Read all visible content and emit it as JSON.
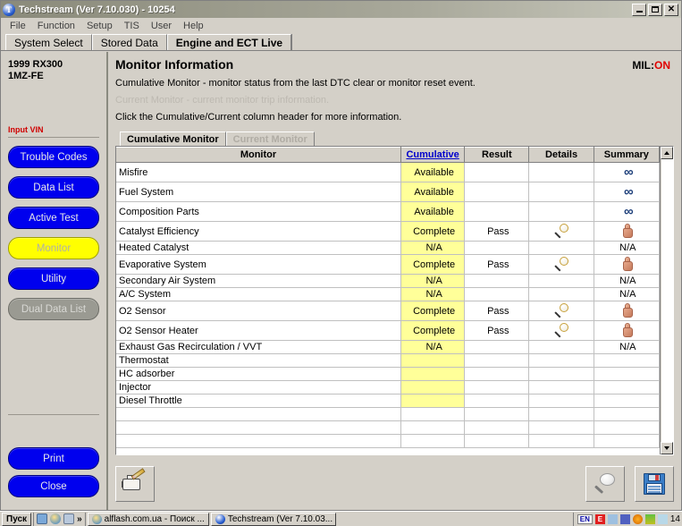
{
  "window": {
    "title": "Techstream (Ver 7.10.030) - 10254",
    "icon": "techstream-logo-icon",
    "minimize_label": "Minimize",
    "maximize_label": "Maximize",
    "close_label": "Close"
  },
  "menubar": {
    "items": [
      "File",
      "Function",
      "Setup",
      "TIS",
      "User",
      "Help"
    ]
  },
  "top_tabs": [
    {
      "label": "System Select",
      "active": false
    },
    {
      "label": "Stored Data",
      "active": false
    },
    {
      "label": "Engine and ECT Live",
      "active": true
    }
  ],
  "sidebar": {
    "vehicle_line1": "1999 RX300",
    "vehicle_line2": "1MZ-FE",
    "vin_label": "Input VIN",
    "nav_buttons": [
      {
        "label": "Trouble Codes",
        "state": "normal"
      },
      {
        "label": "Data List",
        "state": "normal"
      },
      {
        "label": "Active Test",
        "state": "normal"
      },
      {
        "label": "Monitor",
        "state": "selected"
      },
      {
        "label": "Utility",
        "state": "normal"
      },
      {
        "label": "Dual Data List",
        "state": "disabled"
      }
    ],
    "bottom_buttons": [
      {
        "label": "Print"
      },
      {
        "label": "Close"
      }
    ]
  },
  "main": {
    "title": "Monitor Information",
    "mil_label": "MIL:",
    "mil_value": "ON",
    "mil_color": "#e00000",
    "descriptions": [
      {
        "text": "Cumulative Monitor - monitor status from the last DTC clear or monitor reset event.",
        "dim": false
      },
      {
        "text": "Current Monitor - current monitor trip information.",
        "dim": true
      },
      {
        "text": "Click the Cumulative/Current column header for more information.",
        "dim": false
      }
    ],
    "inner_tabs": [
      {
        "label": "Cumulative Monitor",
        "state": "active"
      },
      {
        "label": "Current Monitor",
        "state": "disabled"
      }
    ]
  },
  "table": {
    "columns": [
      "Monitor",
      "Cumulative",
      "Result",
      "Details",
      "Summary"
    ],
    "cumulative_is_link": true,
    "rows": [
      {
        "monitor": "Misfire",
        "cumulative": "Available",
        "result": "",
        "details": "",
        "summary": "infinity",
        "summary_text": "",
        "height": "tall"
      },
      {
        "monitor": "Fuel System",
        "cumulative": "Available",
        "result": "",
        "details": "",
        "summary": "infinity",
        "summary_text": "",
        "height": "tall"
      },
      {
        "monitor": "Composition Parts",
        "cumulative": "Available",
        "result": "",
        "details": "",
        "summary": "infinity",
        "summary_text": "",
        "height": "tall"
      },
      {
        "monitor": "Catalyst Efficiency",
        "cumulative": "Complete",
        "result": "Pass",
        "details": "magnifier",
        "summary": "thumbsup",
        "summary_text": "",
        "height": "tall"
      },
      {
        "monitor": "Heated Catalyst",
        "cumulative": "N/A",
        "result": "",
        "details": "",
        "summary": "text",
        "summary_text": "N/A",
        "height": "short"
      },
      {
        "monitor": "Evaporative System",
        "cumulative": "Complete",
        "result": "Pass",
        "details": "magnifier",
        "summary": "thumbsup",
        "summary_text": "",
        "height": "tall"
      },
      {
        "monitor": "Secondary Air System",
        "cumulative": "N/A",
        "result": "",
        "details": "",
        "summary": "text",
        "summary_text": "N/A",
        "height": "short"
      },
      {
        "monitor": "A/C System",
        "cumulative": "N/A",
        "result": "",
        "details": "",
        "summary": "text",
        "summary_text": "N/A",
        "height": "short"
      },
      {
        "monitor": "O2 Sensor",
        "cumulative": "Complete",
        "result": "Pass",
        "details": "magnifier",
        "summary": "thumbsup",
        "summary_text": "",
        "height": "tall"
      },
      {
        "monitor": "O2 Sensor Heater",
        "cumulative": "Complete",
        "result": "Pass",
        "details": "magnifier",
        "summary": "thumbsup",
        "summary_text": "",
        "height": "tall"
      },
      {
        "monitor": "Exhaust Gas Recirculation / VVT",
        "cumulative": "N/A",
        "result": "",
        "details": "",
        "summary": "text",
        "summary_text": "N/A",
        "height": "short"
      },
      {
        "monitor": "Thermostat",
        "cumulative": "",
        "result": "",
        "details": "",
        "summary": "text",
        "summary_text": "",
        "height": "short"
      },
      {
        "monitor": "HC adsorber",
        "cumulative": "",
        "result": "",
        "details": "",
        "summary": "text",
        "summary_text": "",
        "height": "short"
      },
      {
        "monitor": "Injector",
        "cumulative": "",
        "result": "",
        "details": "",
        "summary": "text",
        "summary_text": "",
        "height": "short"
      },
      {
        "monitor": "Diesel Throttle",
        "cumulative": "",
        "result": "",
        "details": "",
        "summary": "text",
        "summary_text": "",
        "height": "short"
      },
      {
        "monitor": "",
        "cumulative": "",
        "result": "",
        "details": "",
        "summary": "text",
        "summary_text": "",
        "height": "short",
        "blank": true
      },
      {
        "monitor": "",
        "cumulative": "",
        "result": "",
        "details": "",
        "summary": "text",
        "summary_text": "",
        "height": "short",
        "blank": true
      },
      {
        "monitor": "",
        "cumulative": "",
        "result": "",
        "details": "",
        "summary": "text",
        "summary_text": "",
        "height": "short",
        "blank": true
      }
    ],
    "highlight_color": "#ffff99"
  },
  "toolbar": {
    "left_button": {
      "name": "clear-monitor-button",
      "icon": "engine-pencil-icon"
    },
    "right_buttons": [
      {
        "name": "zoom-button",
        "icon": "magnifier-icon"
      },
      {
        "name": "save-button",
        "icon": "floppy-disk-icon"
      }
    ]
  },
  "taskbar": {
    "start_label": "Пуск",
    "quicklaunch_more": "»",
    "tasks": [
      {
        "label": "alflash.com.ua - Поиск ...",
        "icon": "browser-icon"
      },
      {
        "label": "Techstream (Ver 7.10.03...",
        "icon": "techstream-logo-icon"
      }
    ],
    "language": "EN",
    "clock": "14"
  }
}
